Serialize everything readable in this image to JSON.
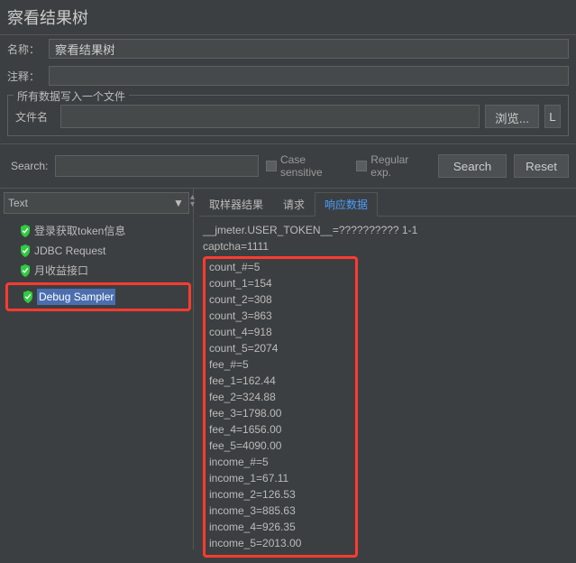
{
  "title": "察看结果树",
  "form": {
    "name_label": "名称：",
    "name_value": "察看结果树",
    "comment_label": "注释："
  },
  "file_section": {
    "legend": "所有数据写入一个文件",
    "file_label": "文件名",
    "browse": "浏览...",
    "log_btn": "L"
  },
  "search": {
    "label": "Search:",
    "case": "Case sensitive",
    "regex": "Regular exp.",
    "search_btn": "Search",
    "reset_btn": "Reset"
  },
  "combo": {
    "value": "Text"
  },
  "tree": [
    {
      "label": "登录获取token信息",
      "selected": false
    },
    {
      "label": "JDBC Request",
      "selected": false
    },
    {
      "label": "月收益接口",
      "selected": false
    },
    {
      "label": "Debug Sampler",
      "selected": true
    }
  ],
  "tabs": {
    "t1": "取样器结果",
    "t2": "请求",
    "t3": "响应数据"
  },
  "response": {
    "header1": "__jmeter.USER_TOKEN__=?????????? 1-1",
    "header2": "captcha=1111",
    "lines": [
      "count_#=5",
      "count_1=154",
      "count_2=308",
      "count_3=863",
      "count_4=918",
      "count_5=2074",
      "fee_#=5",
      "fee_1=162.44",
      "fee_2=324.88",
      "fee_3=1798.00",
      "fee_4=1656.00",
      "fee_5=4090.00",
      "income_#=5",
      "income_1=67.11",
      "income_2=126.53",
      "income_3=885.63",
      "income_4=926.35",
      "income_5=2013.00"
    ]
  }
}
